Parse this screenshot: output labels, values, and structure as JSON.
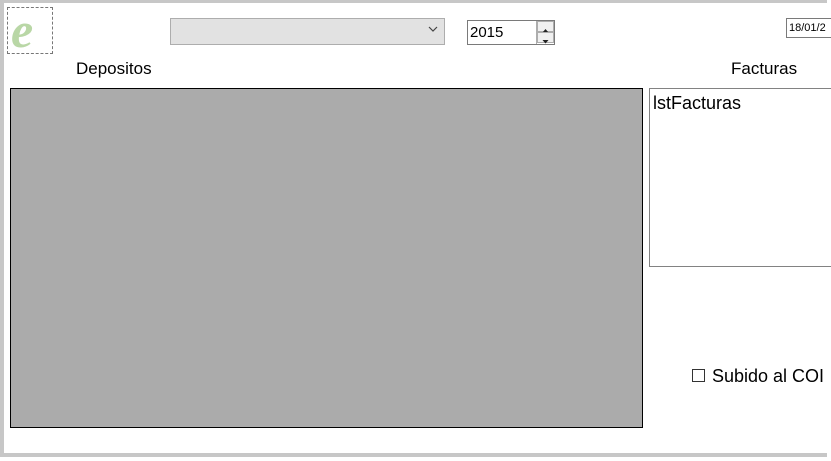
{
  "header": {
    "combo": {
      "value": ""
    },
    "year": {
      "value": "2015"
    },
    "date": {
      "value": "18/01/2"
    }
  },
  "labels": {
    "depositos": "Depositos",
    "facturas": "Facturas"
  },
  "facturas_list": {
    "items": [
      "lstFacturas"
    ]
  },
  "checkbox": {
    "label": "Subido al COI",
    "checked": false
  },
  "colors": {
    "grid_bg": "#ababab",
    "frame": "#c7c7c7",
    "logo": "#b9d7a6"
  },
  "icons": {
    "logo": "e-letter-logo-icon",
    "combo_arrow": "chevron-down-icon",
    "spin_up": "spin-up-icon",
    "spin_down": "spin-down-icon"
  }
}
